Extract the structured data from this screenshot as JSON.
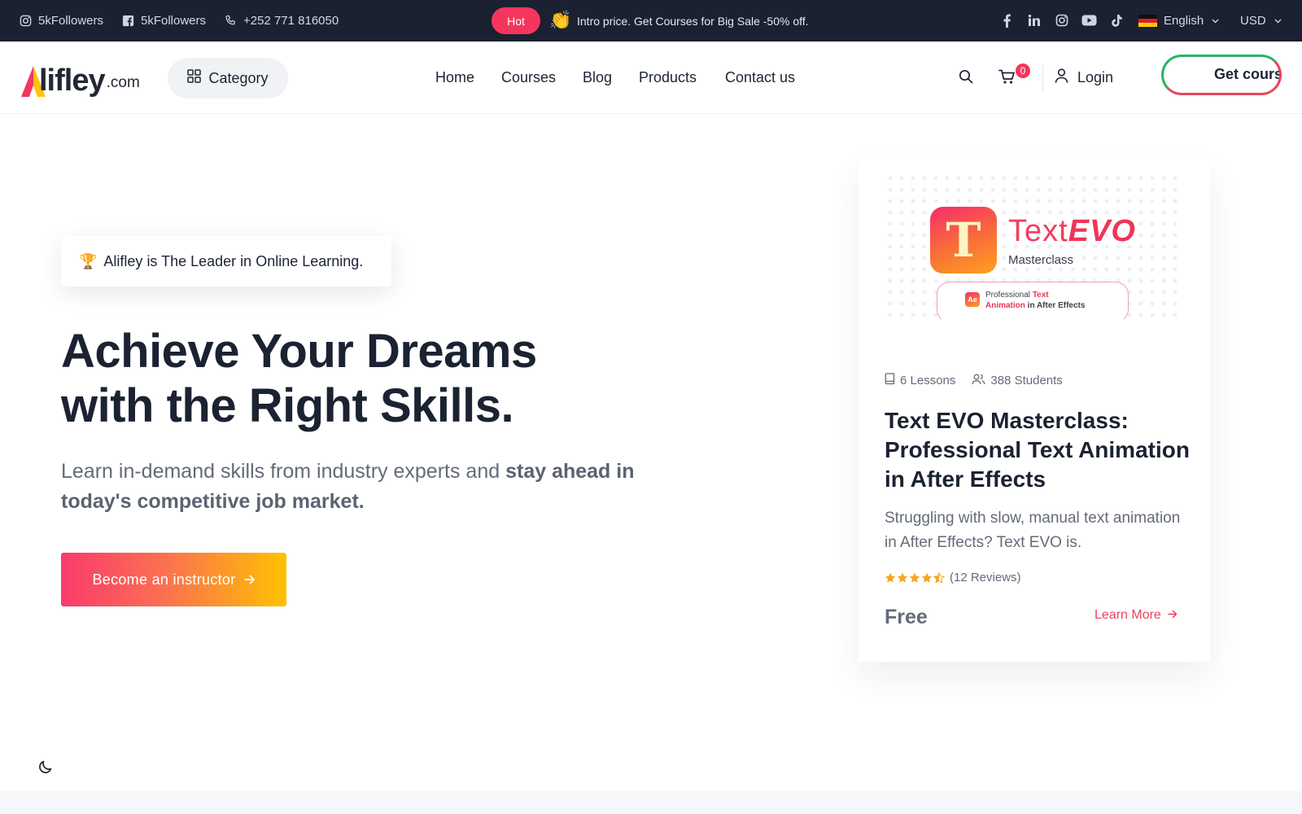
{
  "topbar": {
    "instagram_followers": "5kFollowers",
    "facebook_followers": "5kFollowers",
    "phone": "+252 771 816050",
    "hot_label": "Hot",
    "promo_emoji": "👏",
    "promo_text": "Intro price. Get Courses for Big Sale -50% off.",
    "socials": [
      "facebook-icon",
      "linkedin-icon",
      "instagram-icon",
      "youtube-icon",
      "tiktok-icon"
    ],
    "language": "English",
    "currency": "USD"
  },
  "header": {
    "logo_word": "lifley",
    "logo_domain": ".com",
    "category_label": "Category",
    "nav": [
      "Home",
      "Courses",
      "Blog",
      "Products",
      "Contact us"
    ],
    "cart_count": "0",
    "login_label": "Login",
    "get_course_label": "Get course"
  },
  "hero": {
    "badge_emoji": "🏆",
    "badge_text": "Alifley is The Leader in Online Learning.",
    "title_line1": "Achieve Your Dreams",
    "title_line2": "with the Right Skills.",
    "subtitle_plain": "Learn in-demand skills from industry experts and ",
    "subtitle_bold": "stay ahead in today's competitive job market.",
    "cta_label": "Become an instructor"
  },
  "course_card": {
    "thumb_letter": "T",
    "thumb_title_text": "Text",
    "thumb_title_evo": "EVO",
    "thumb_subtitle": "Masterclass",
    "thumb_badge_icon": "Ae",
    "thumb_badge_line1_a": "Professional ",
    "thumb_badge_line1_b": "Text",
    "thumb_badge_line2_a": "Animation",
    "thumb_badge_line2_b": " in After Effects",
    "lessons": "6 Lessons",
    "students": "388 Students",
    "title": "Text EVO Masterclass: Professional Text Animation in After Effects",
    "description": "Struggling with slow, manual text animation in After Effects? Text EVO is.",
    "rating": 4.5,
    "reviews": "(12 Reviews)",
    "price": "Free",
    "learn_more": "Learn More"
  },
  "colors": {
    "topbar_bg": "#1b2130",
    "accent_red": "#f4365d",
    "cta_gradient_start": "#f93b6c",
    "cta_gradient_end": "#fec100",
    "star": "#f5a623"
  }
}
